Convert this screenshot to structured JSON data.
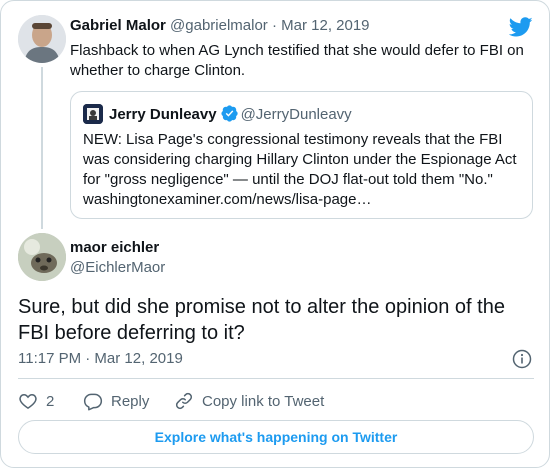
{
  "parent_tweet": {
    "author_name": "Gabriel Malor",
    "handle": "@gabrielmalor",
    "separator": "·",
    "date": "Mar 12, 2019",
    "text": "Flashback to when AG Lynch testified that she would defer to FBI on whether to charge Clinton."
  },
  "quoted_tweet": {
    "author_name": "Jerry Dunleavy",
    "handle": "@JerryDunleavy",
    "text": "NEW: Lisa Page's congressional testimony reveals that the FBI was considering charging Hillary Clinton under the Espionage Act for \"gross negligence\" — until the DOJ flat-out told them \"No.\" washingtonexaminer.com/news/lisa-page…"
  },
  "main_tweet": {
    "author_name": "maor eichler",
    "handle": "@EichlerMaor",
    "text": "Sure, but did she promise not to alter the opinion of the FBI before deferring to it?",
    "timestamp": "11:17 PM · Mar 12, 2019"
  },
  "actions": {
    "like_count": "2",
    "reply_label": "Reply",
    "copy_link_label": "Copy link to Tweet"
  },
  "footer": {
    "explore_label": "Explore what's happening on Twitter"
  },
  "colors": {
    "accent": "#1d9bf0",
    "secondary_text": "#536471",
    "border": "#cfd9de"
  },
  "icons": [
    "twitter-bird-icon",
    "verified-badge-icon",
    "info-icon",
    "heart-icon",
    "reply-icon",
    "link-icon"
  ]
}
